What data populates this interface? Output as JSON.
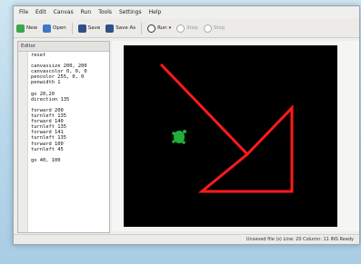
{
  "menu": [
    "File",
    "Edit",
    "Canvas",
    "Run",
    "Tools",
    "Settings",
    "Help"
  ],
  "toolbar": {
    "new": "New",
    "open": "Open",
    "save": "Save",
    "save_as": "Save As",
    "run": "Run",
    "step": "Step",
    "stop": "Stop"
  },
  "editor": {
    "title": "Editor",
    "lines": [
      "reset",
      "",
      "canvassize 200, 200",
      "canvascolor 0, 0, 0",
      "pencolor 255, 0, 0",
      "penwidth 1",
      "",
      "go 20,20",
      "direction 135",
      "",
      "forward 200",
      "turnleft 135",
      "forward 140",
      "turnleft 135",
      "forward 141",
      "turnleft 135",
      "forward 100",
      "turnleft 45",
      "",
      "go 40, 100"
    ]
  },
  "status": {
    "text": "Unsaved file (s)   Line: 20 Column: 11   INS   Ready"
  },
  "colors": {
    "canvas_background": "#000000",
    "pen": "#ff1a1a",
    "turtle": "#1fae3a"
  },
  "drawing": {
    "pen_color_rgb": [
      255,
      0,
      0
    ],
    "canvas_color_rgb": [
      0,
      0,
      0
    ]
  }
}
